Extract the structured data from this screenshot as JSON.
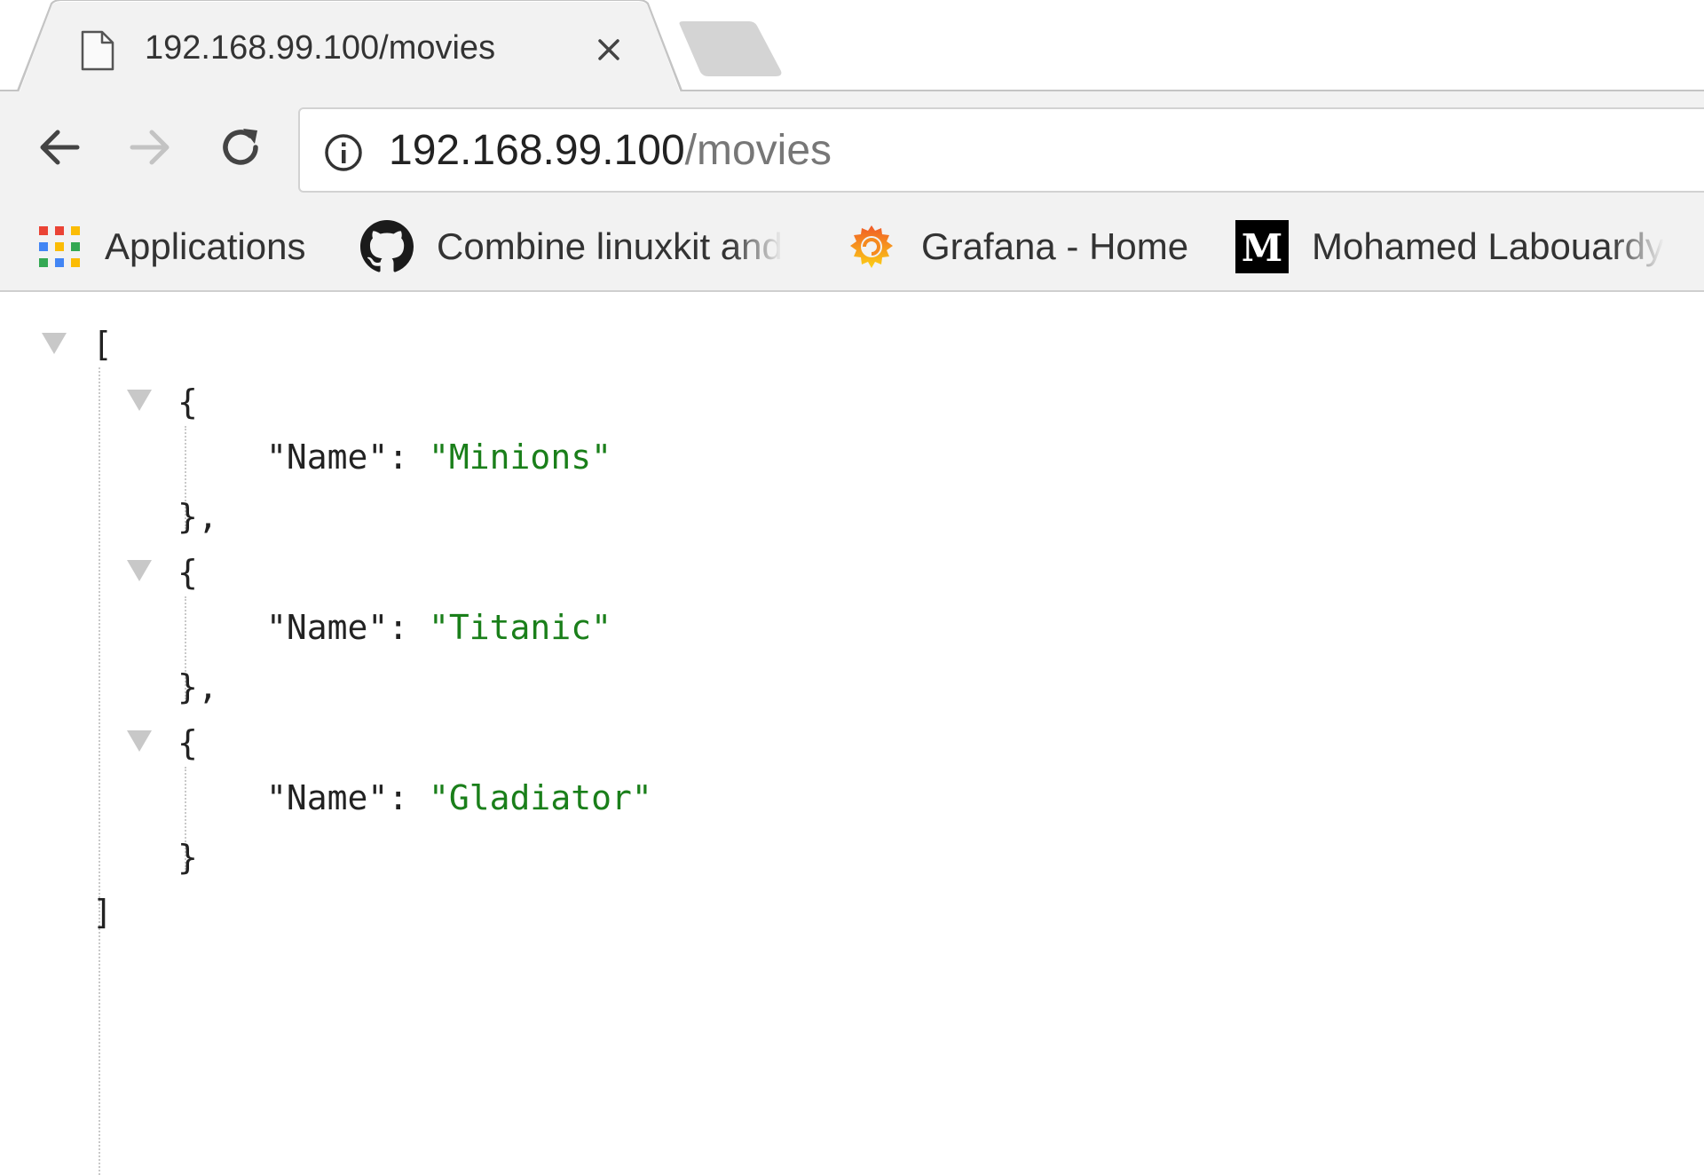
{
  "tab": {
    "title": "192.168.99.100/movies",
    "close_glyph": "×",
    "icon": "page-icon"
  },
  "toolbar": {
    "back_icon": "back-arrow-icon",
    "forward_icon": "forward-arrow-icon",
    "reload_icon": "reload-icon",
    "url_host": "192.168.99.100",
    "url_path": "/movies",
    "info_icon": "info-icon"
  },
  "bookmarks": [
    {
      "label": "Applications",
      "icon": "apps-grid-icon"
    },
    {
      "label": "Combine linuxkit and",
      "icon": "github-icon"
    },
    {
      "label": "Grafana - Home",
      "icon": "grafana-icon"
    },
    {
      "label": "Mohamed Labouardy",
      "icon": "medium-icon"
    }
  ],
  "json": {
    "open_bracket": "[",
    "close_bracket": "]",
    "items": [
      {
        "key": "\"Name\"",
        "value": "\"Minions\"",
        "open": "{",
        "close": "},",
        "sep": ": "
      },
      {
        "key": "\"Name\"",
        "value": "\"Titanic\"",
        "open": "{",
        "close": "},",
        "sep": ": "
      },
      {
        "key": "\"Name\"",
        "value": "\"Gladiator\"",
        "open": "{",
        "close": "}",
        "sep": ": "
      }
    ]
  },
  "colors": {
    "chrome_bg": "#f2f2f2",
    "string_value": "#1a7f1a",
    "url_path": "#777777"
  }
}
